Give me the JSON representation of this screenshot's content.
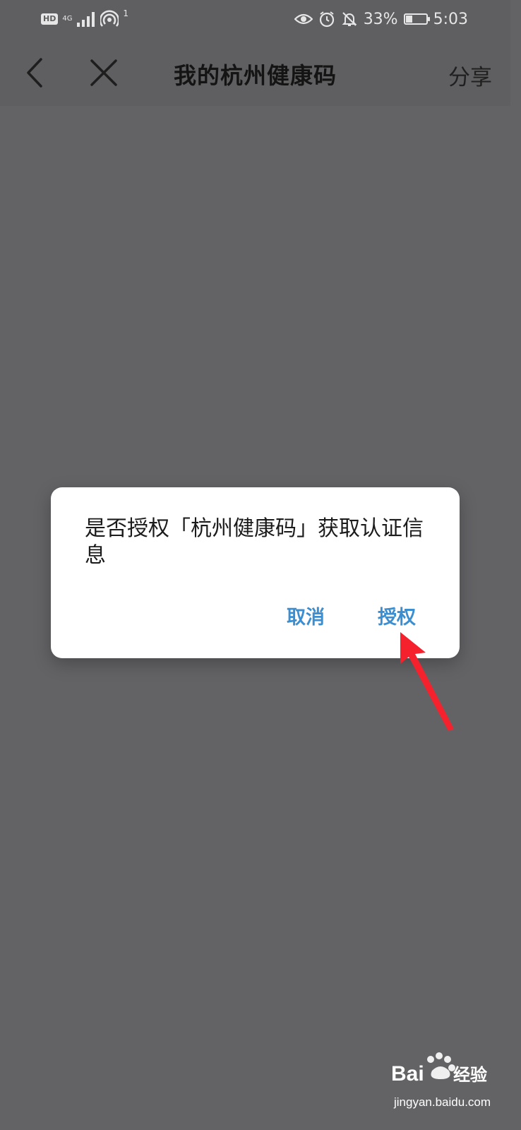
{
  "status_bar": {
    "hd_badge": "HD",
    "network_type": "4G",
    "hotspot_count": "1",
    "battery_percent": "33%",
    "battery_level": 0.33,
    "time": "5:03",
    "icons": [
      "eye-icon",
      "alarm-icon",
      "mute-bell-icon",
      "battery-icon"
    ]
  },
  "nav": {
    "title": "我的杭州健康码",
    "share_label": "分享"
  },
  "dialog": {
    "message": "是否授权「杭州健康码」获取认证信息",
    "cancel_label": "取消",
    "confirm_label": "授权",
    "accent_color": "#3b8ed0"
  },
  "watermark": {
    "brand": "Baidu经验",
    "url": "jingyan.baidu.com"
  },
  "colors": {
    "overlay_background": "#636366",
    "annotation_arrow": "#f5222d"
  }
}
